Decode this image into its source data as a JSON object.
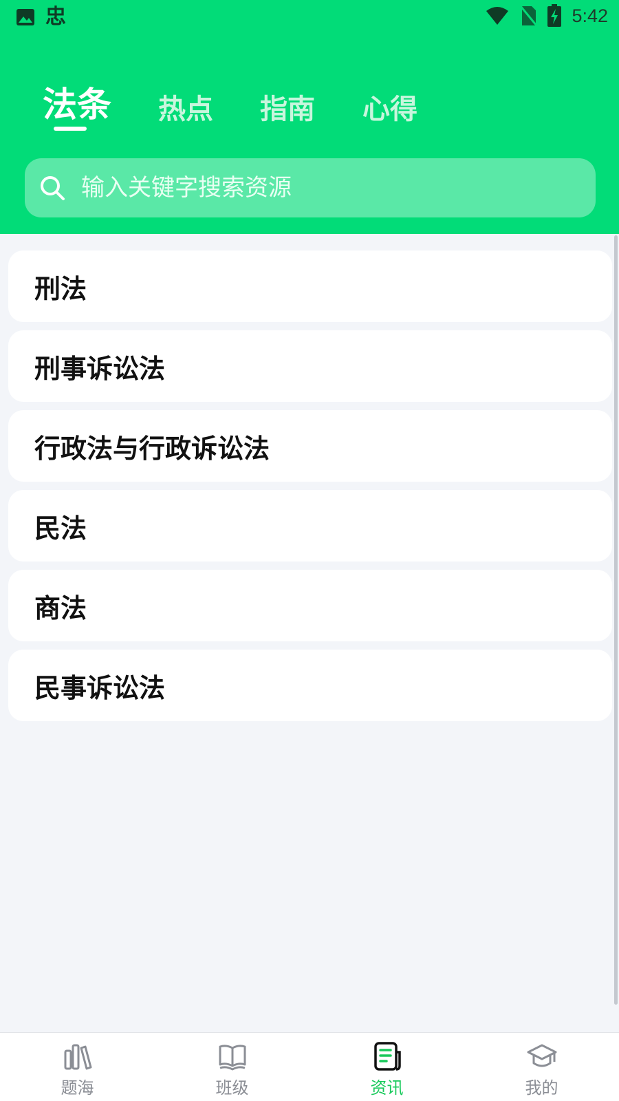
{
  "status_bar": {
    "app_glyph": "忠",
    "time": "5:42",
    "icons": [
      "image-icon",
      "wifi-icon",
      "no-sim-icon",
      "battery-charging-icon"
    ]
  },
  "tabs": [
    {
      "label": "法条",
      "active": true
    },
    {
      "label": "热点",
      "active": false
    },
    {
      "label": "指南",
      "active": false
    },
    {
      "label": "心得",
      "active": false
    }
  ],
  "search": {
    "placeholder": "输入关键字搜索资源",
    "icon": "search-icon"
  },
  "list": [
    {
      "label": "刑法"
    },
    {
      "label": "刑事诉讼法"
    },
    {
      "label": "行政法与行政诉讼法"
    },
    {
      "label": "民法"
    },
    {
      "label": "商法"
    },
    {
      "label": "民事诉讼法"
    }
  ],
  "bottom_nav": [
    {
      "label": "题海",
      "icon": "books-icon",
      "active": false
    },
    {
      "label": "班级",
      "icon": "open-book-icon",
      "active": false
    },
    {
      "label": "资讯",
      "icon": "news-icon",
      "active": true
    },
    {
      "label": "我的",
      "icon": "graduation-cap-icon",
      "active": false
    }
  ],
  "colors": {
    "header_green": "#02dc78",
    "active_nav": "#18c95b",
    "background": "#f3f5f9"
  }
}
